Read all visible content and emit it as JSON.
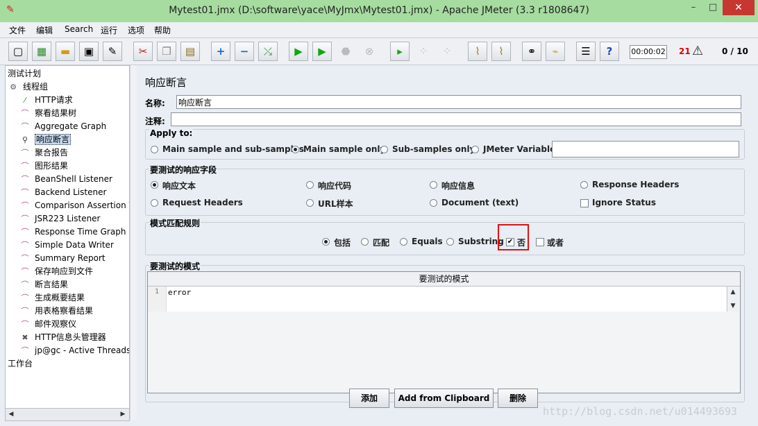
{
  "window": {
    "title": "Mytest01.jmx (D:\\software\\yace\\MyJmx\\Mytest01.jmx) - Apache JMeter (3.3 r1808647)",
    "min_glyph": "–",
    "max_glyph": "□",
    "close_glyph": "✕"
  },
  "menu": [
    "文件",
    "编辑",
    "Search",
    "运行",
    "选项",
    "帮助"
  ],
  "toolbar": {
    "icons": [
      "new-icon",
      "templates-icon",
      "open-icon",
      "save-icon",
      "save-as-icon",
      "cut-icon",
      "copy-icon",
      "paste-icon",
      "expand-icon",
      "collapse-icon",
      "toggle-icon",
      "start-icon",
      "start-no-pauses-icon",
      "stop-icon",
      "shutdown-icon",
      "remote-start-icon",
      "remote-stop-icon",
      "remote-shutdown-icon",
      "clear-icon",
      "clear-all-icon",
      "search-icon",
      "reset-search-icon",
      "function-helper-icon",
      "help-icon"
    ],
    "timer": "00:00:02",
    "error_count": "21",
    "threads": "0 / 10"
  },
  "tree": {
    "root": "测试计划",
    "thread_group": "线程组",
    "children": [
      {
        "label": "HTTP请求",
        "icon": "sampler-icon"
      },
      {
        "label": "察看结果树",
        "icon": "listener-icon"
      },
      {
        "label": "Aggregate Graph",
        "icon": "listener-icon"
      },
      {
        "label": "响应断言",
        "icon": "assertion-icon",
        "selected": true
      },
      {
        "label": "聚合报告",
        "icon": "listener-icon"
      },
      {
        "label": "图形结果",
        "icon": "listener-icon"
      },
      {
        "label": "BeanShell Listener",
        "icon": "listener-icon"
      },
      {
        "label": "Backend Listener",
        "icon": "listener-icon"
      },
      {
        "label": "Comparison Assertion V",
        "icon": "listener-icon"
      },
      {
        "label": "JSR223 Listener",
        "icon": "listener-icon"
      },
      {
        "label": "Response Time Graph",
        "icon": "listener-icon"
      },
      {
        "label": "Simple Data Writer",
        "icon": "listener-icon"
      },
      {
        "label": "Summary Report",
        "icon": "listener-icon"
      },
      {
        "label": "保存响应到文件",
        "icon": "listener-icon"
      },
      {
        "label": "断言结果",
        "icon": "listener-icon"
      },
      {
        "label": "生成概要结果",
        "icon": "listener-icon"
      },
      {
        "label": "用表格察看结果",
        "icon": "listener-icon"
      },
      {
        "label": "邮件观察仪",
        "icon": "listener-icon"
      },
      {
        "label": "HTTP信息头管理器",
        "icon": "config-icon"
      },
      {
        "label": "jp@gc - Active Threads C",
        "icon": "listener-icon"
      }
    ],
    "workbench": "工作台"
  },
  "panel": {
    "title": "响应断言",
    "name_label": "名称:",
    "name_value": "响应断言",
    "comment_label": "注释:",
    "comment_value": "",
    "apply_to": {
      "label": "Apply to:",
      "options": [
        "Main sample and sub-samples",
        "Main sample only",
        "Sub-samples only",
        "JMeter Variable"
      ],
      "selected": "Main sample only",
      "variable_value": ""
    },
    "field_to_test": {
      "label": "要测试的响应字段",
      "options": [
        "响应文本",
        "响应代码",
        "响应信息",
        "Response Headers",
        "Request Headers",
        "URL样本",
        "Document (text)"
      ],
      "selected": "响应文本",
      "ignore_status": "Ignore Status"
    },
    "matching_rules": {
      "label": "模式匹配规则",
      "options": [
        "包括",
        "匹配",
        "Equals",
        "Substring"
      ],
      "selected": "包括",
      "not_label": "否",
      "not_checked": true,
      "or_label": "或者",
      "or_checked": false,
      "highlight_color": "#e01010"
    },
    "patterns": {
      "label": "要测试的模式",
      "column_header": "要测试的模式",
      "rows": [
        {
          "line": "1",
          "text": "error"
        }
      ]
    },
    "buttons": {
      "add": "添加",
      "add_clipboard": "Add from Clipboard",
      "delete": "删除"
    }
  },
  "watermark": "http://blog.csdn.net/u014493693"
}
